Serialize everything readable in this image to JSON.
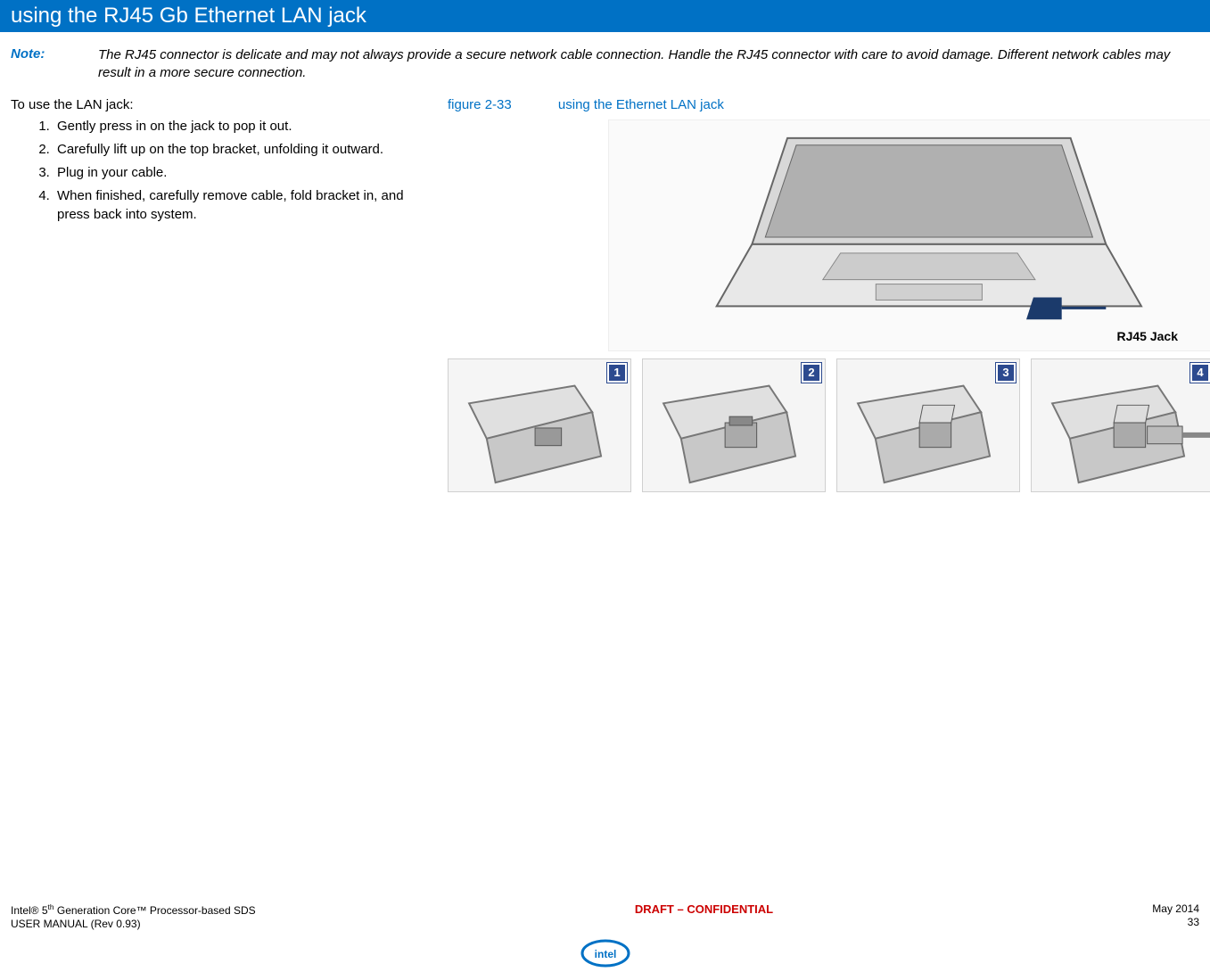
{
  "header": {
    "title": "using the RJ45 Gb Ethernet LAN jack"
  },
  "note": {
    "label": "Note:",
    "text": "The RJ45 connector is delicate and may not always provide a secure network cable connection. Handle the RJ45 connector with care to avoid damage. Different network cables may result in a more secure connection."
  },
  "intro": "To use the LAN jack:",
  "steps": [
    "Gently press in on the jack to pop it out.",
    "Carefully lift up on the top bracket, unfolding it outward.",
    "Plug in your cable.",
    "When finished, carefully remove cable, fold bracket in, and press back into system."
  ],
  "figure": {
    "label": "figure 2-33",
    "caption": "using the Ethernet LAN jack",
    "callout": "RJ45 Jack",
    "step_badges": [
      "1",
      "2",
      "3",
      "4"
    ]
  },
  "footer": {
    "left_line1_prefix": "Intel® 5",
    "left_line1_sup": "th",
    "left_line1_suffix": " Generation Core™ Processor-based SDS",
    "left_line2": "USER MANUAL (Rev 0.93)",
    "center": "DRAFT – CONFIDENTIAL",
    "right_line1": "May 2014",
    "right_line2": "33"
  }
}
